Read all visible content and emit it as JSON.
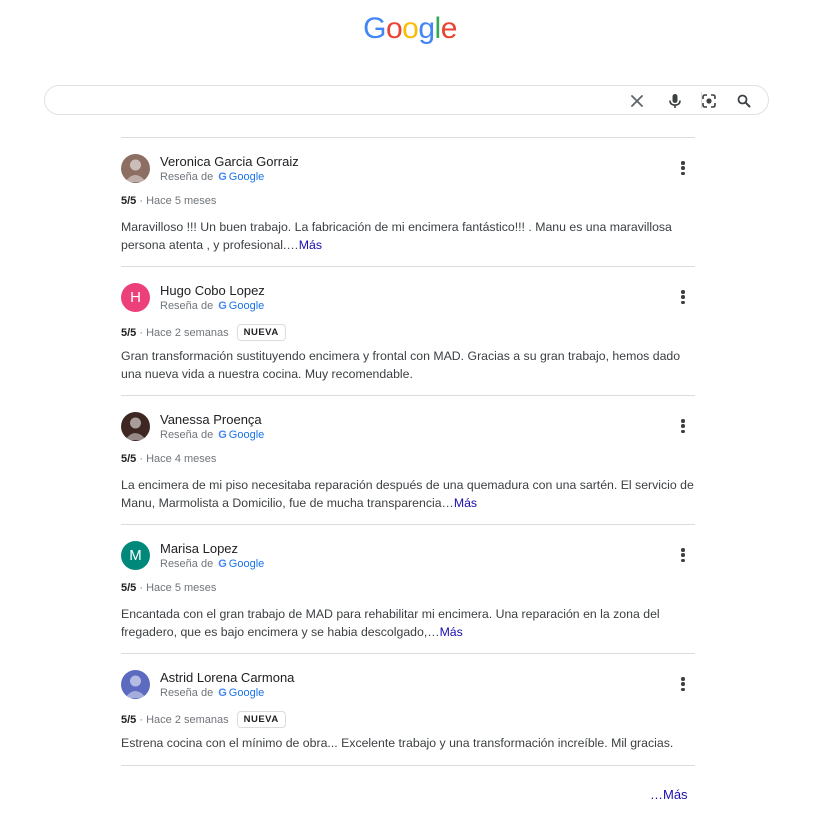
{
  "logo": {
    "text": "Google",
    "colors": [
      "#4285F4",
      "#EA4335",
      "#FBBC05",
      "#4285F4",
      "#34A853",
      "#EA4335"
    ]
  },
  "search": {
    "value": "",
    "placeholder": ""
  },
  "reviews": [
    {
      "name": "Veronica Garcia Gorraiz",
      "source_prefix": "Reseña de",
      "source": "Google",
      "rating": "5/5",
      "time": "Hace 5 meses",
      "badge": "",
      "text": "Maravilloso !!! Un buen trabajo. La fabricación de mi encimera fantástico!!! . Manu es una maravillosa persona atenta , y profesional.…",
      "more": "Más",
      "avatar": {
        "type": "photo",
        "letter": "",
        "color": "#8d6e63"
      }
    },
    {
      "name": "Hugo Cobo Lopez",
      "source_prefix": "Reseña de",
      "source": "Google",
      "rating": "5/5",
      "time": "Hace 2 semanas",
      "badge": "NUEVA",
      "text": "Gran transformación sustituyendo encimera y frontal con MAD. Gracias a su gran trabajo, hemos dado una nueva vida a nuestra cocina. Muy recomendable.",
      "more": "",
      "avatar": {
        "type": "letter",
        "letter": "H",
        "color": "#ec407a"
      }
    },
    {
      "name": "Vanessa Proença",
      "source_prefix": "Reseña de",
      "source": "Google",
      "rating": "5/5",
      "time": "Hace 4 meses",
      "badge": "",
      "text": "La encimera de mi piso necesitaba reparación después de una quemadura con una sartén. El servicio de Manu, Marmolista a Domicilio, fue de mucha transparencia…",
      "more": "Más",
      "avatar": {
        "type": "photo",
        "letter": "",
        "color": "#3e2723"
      }
    },
    {
      "name": "Marisa Lopez",
      "source_prefix": "Reseña de",
      "source": "Google",
      "rating": "5/5",
      "time": "Hace 5 meses",
      "badge": "",
      "text": "Encantada con el gran trabajo de MAD para rehabilitar mi encimera. Una reparación en la zona del fregadero, que es bajo encimera y se habia descolgado,…",
      "more": "Más",
      "avatar": {
        "type": "letter",
        "letter": "M",
        "color": "#00897b"
      }
    },
    {
      "name": "Astrid Lorena Carmona",
      "source_prefix": "Reseña de",
      "source": "Google",
      "rating": "5/5",
      "time": "Hace 2 semanas",
      "badge": "NUEVA",
      "text": "Estrena cocina con el mínimo de obra... Excelente trabajo y una transformación increíble. Mil gracias.",
      "more": "",
      "avatar": {
        "type": "photo",
        "letter": "",
        "color": "#5c6bc0"
      }
    }
  ],
  "footer": {
    "more": "…Más"
  }
}
